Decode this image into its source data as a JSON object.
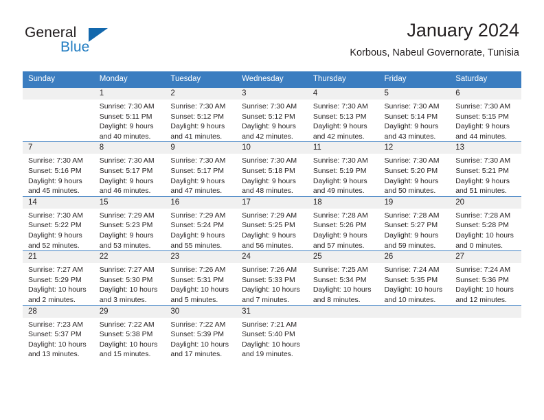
{
  "brand": {
    "name_part1": "General",
    "name_part2": "Blue",
    "triangle_color": "#1368ad",
    "blue_color": "#1f7bc1"
  },
  "header": {
    "title": "January 2024",
    "subtitle": "Korbous, Nabeul Governorate, Tunisia"
  },
  "theme": {
    "header_row_bg": "#3b7dc0",
    "daynum_strip_bg": "#f0f0f0",
    "grid_line": "#3b7dc0",
    "text": "#231f20"
  },
  "weekday_headers": [
    "Sunday",
    "Monday",
    "Tuesday",
    "Wednesday",
    "Thursday",
    "Friday",
    "Saturday"
  ],
  "labels": {
    "sunrise_prefix": "Sunrise:",
    "sunset_prefix": "Sunset:",
    "daylight_prefix": "Daylight:"
  },
  "weeks": [
    {
      "days": [
        {
          "num": "",
          "empty": true,
          "sunrise": "",
          "sunset": "",
          "daylight_line1": "",
          "daylight_line2": ""
        },
        {
          "num": "1",
          "empty": false,
          "sunrise": "Sunrise: 7:30 AM",
          "sunset": "Sunset: 5:11 PM",
          "daylight_line1": "Daylight: 9 hours",
          "daylight_line2": "and 40 minutes."
        },
        {
          "num": "2",
          "empty": false,
          "sunrise": "Sunrise: 7:30 AM",
          "sunset": "Sunset: 5:12 PM",
          "daylight_line1": "Daylight: 9 hours",
          "daylight_line2": "and 41 minutes."
        },
        {
          "num": "3",
          "empty": false,
          "sunrise": "Sunrise: 7:30 AM",
          "sunset": "Sunset: 5:12 PM",
          "daylight_line1": "Daylight: 9 hours",
          "daylight_line2": "and 42 minutes."
        },
        {
          "num": "4",
          "empty": false,
          "sunrise": "Sunrise: 7:30 AM",
          "sunset": "Sunset: 5:13 PM",
          "daylight_line1": "Daylight: 9 hours",
          "daylight_line2": "and 42 minutes."
        },
        {
          "num": "5",
          "empty": false,
          "sunrise": "Sunrise: 7:30 AM",
          "sunset": "Sunset: 5:14 PM",
          "daylight_line1": "Daylight: 9 hours",
          "daylight_line2": "and 43 minutes."
        },
        {
          "num": "6",
          "empty": false,
          "sunrise": "Sunrise: 7:30 AM",
          "sunset": "Sunset: 5:15 PM",
          "daylight_line1": "Daylight: 9 hours",
          "daylight_line2": "and 44 minutes."
        }
      ]
    },
    {
      "days": [
        {
          "num": "7",
          "empty": false,
          "sunrise": "Sunrise: 7:30 AM",
          "sunset": "Sunset: 5:16 PM",
          "daylight_line1": "Daylight: 9 hours",
          "daylight_line2": "and 45 minutes."
        },
        {
          "num": "8",
          "empty": false,
          "sunrise": "Sunrise: 7:30 AM",
          "sunset": "Sunset: 5:17 PM",
          "daylight_line1": "Daylight: 9 hours",
          "daylight_line2": "and 46 minutes."
        },
        {
          "num": "9",
          "empty": false,
          "sunrise": "Sunrise: 7:30 AM",
          "sunset": "Sunset: 5:17 PM",
          "daylight_line1": "Daylight: 9 hours",
          "daylight_line2": "and 47 minutes."
        },
        {
          "num": "10",
          "empty": false,
          "sunrise": "Sunrise: 7:30 AM",
          "sunset": "Sunset: 5:18 PM",
          "daylight_line1": "Daylight: 9 hours",
          "daylight_line2": "and 48 minutes."
        },
        {
          "num": "11",
          "empty": false,
          "sunrise": "Sunrise: 7:30 AM",
          "sunset": "Sunset: 5:19 PM",
          "daylight_line1": "Daylight: 9 hours",
          "daylight_line2": "and 49 minutes."
        },
        {
          "num": "12",
          "empty": false,
          "sunrise": "Sunrise: 7:30 AM",
          "sunset": "Sunset: 5:20 PM",
          "daylight_line1": "Daylight: 9 hours",
          "daylight_line2": "and 50 minutes."
        },
        {
          "num": "13",
          "empty": false,
          "sunrise": "Sunrise: 7:30 AM",
          "sunset": "Sunset: 5:21 PM",
          "daylight_line1": "Daylight: 9 hours",
          "daylight_line2": "and 51 minutes."
        }
      ]
    },
    {
      "days": [
        {
          "num": "14",
          "empty": false,
          "sunrise": "Sunrise: 7:30 AM",
          "sunset": "Sunset: 5:22 PM",
          "daylight_line1": "Daylight: 9 hours",
          "daylight_line2": "and 52 minutes."
        },
        {
          "num": "15",
          "empty": false,
          "sunrise": "Sunrise: 7:29 AM",
          "sunset": "Sunset: 5:23 PM",
          "daylight_line1": "Daylight: 9 hours",
          "daylight_line2": "and 53 minutes."
        },
        {
          "num": "16",
          "empty": false,
          "sunrise": "Sunrise: 7:29 AM",
          "sunset": "Sunset: 5:24 PM",
          "daylight_line1": "Daylight: 9 hours",
          "daylight_line2": "and 55 minutes."
        },
        {
          "num": "17",
          "empty": false,
          "sunrise": "Sunrise: 7:29 AM",
          "sunset": "Sunset: 5:25 PM",
          "daylight_line1": "Daylight: 9 hours",
          "daylight_line2": "and 56 minutes."
        },
        {
          "num": "18",
          "empty": false,
          "sunrise": "Sunrise: 7:28 AM",
          "sunset": "Sunset: 5:26 PM",
          "daylight_line1": "Daylight: 9 hours",
          "daylight_line2": "and 57 minutes."
        },
        {
          "num": "19",
          "empty": false,
          "sunrise": "Sunrise: 7:28 AM",
          "sunset": "Sunset: 5:27 PM",
          "daylight_line1": "Daylight: 9 hours",
          "daylight_line2": "and 59 minutes."
        },
        {
          "num": "20",
          "empty": false,
          "sunrise": "Sunrise: 7:28 AM",
          "sunset": "Sunset: 5:28 PM",
          "daylight_line1": "Daylight: 10 hours",
          "daylight_line2": "and 0 minutes."
        }
      ]
    },
    {
      "days": [
        {
          "num": "21",
          "empty": false,
          "sunrise": "Sunrise: 7:27 AM",
          "sunset": "Sunset: 5:29 PM",
          "daylight_line1": "Daylight: 10 hours",
          "daylight_line2": "and 2 minutes."
        },
        {
          "num": "22",
          "empty": false,
          "sunrise": "Sunrise: 7:27 AM",
          "sunset": "Sunset: 5:30 PM",
          "daylight_line1": "Daylight: 10 hours",
          "daylight_line2": "and 3 minutes."
        },
        {
          "num": "23",
          "empty": false,
          "sunrise": "Sunrise: 7:26 AM",
          "sunset": "Sunset: 5:31 PM",
          "daylight_line1": "Daylight: 10 hours",
          "daylight_line2": "and 5 minutes."
        },
        {
          "num": "24",
          "empty": false,
          "sunrise": "Sunrise: 7:26 AM",
          "sunset": "Sunset: 5:33 PM",
          "daylight_line1": "Daylight: 10 hours",
          "daylight_line2": "and 7 minutes."
        },
        {
          "num": "25",
          "empty": false,
          "sunrise": "Sunrise: 7:25 AM",
          "sunset": "Sunset: 5:34 PM",
          "daylight_line1": "Daylight: 10 hours",
          "daylight_line2": "and 8 minutes."
        },
        {
          "num": "26",
          "empty": false,
          "sunrise": "Sunrise: 7:24 AM",
          "sunset": "Sunset: 5:35 PM",
          "daylight_line1": "Daylight: 10 hours",
          "daylight_line2": "and 10 minutes."
        },
        {
          "num": "27",
          "empty": false,
          "sunrise": "Sunrise: 7:24 AM",
          "sunset": "Sunset: 5:36 PM",
          "daylight_line1": "Daylight: 10 hours",
          "daylight_line2": "and 12 minutes."
        }
      ]
    },
    {
      "days": [
        {
          "num": "28",
          "empty": false,
          "sunrise": "Sunrise: 7:23 AM",
          "sunset": "Sunset: 5:37 PM",
          "daylight_line1": "Daylight: 10 hours",
          "daylight_line2": "and 13 minutes."
        },
        {
          "num": "29",
          "empty": false,
          "sunrise": "Sunrise: 7:22 AM",
          "sunset": "Sunset: 5:38 PM",
          "daylight_line1": "Daylight: 10 hours",
          "daylight_line2": "and 15 minutes."
        },
        {
          "num": "30",
          "empty": false,
          "sunrise": "Sunrise: 7:22 AM",
          "sunset": "Sunset: 5:39 PM",
          "daylight_line1": "Daylight: 10 hours",
          "daylight_line2": "and 17 minutes."
        },
        {
          "num": "31",
          "empty": false,
          "sunrise": "Sunrise: 7:21 AM",
          "sunset": "Sunset: 5:40 PM",
          "daylight_line1": "Daylight: 10 hours",
          "daylight_line2": "and 19 minutes."
        },
        {
          "num": "",
          "empty": true,
          "sunrise": "",
          "sunset": "",
          "daylight_line1": "",
          "daylight_line2": ""
        },
        {
          "num": "",
          "empty": true,
          "sunrise": "",
          "sunset": "",
          "daylight_line1": "",
          "daylight_line2": ""
        },
        {
          "num": "",
          "empty": true,
          "sunrise": "",
          "sunset": "",
          "daylight_line1": "",
          "daylight_line2": ""
        }
      ]
    }
  ]
}
